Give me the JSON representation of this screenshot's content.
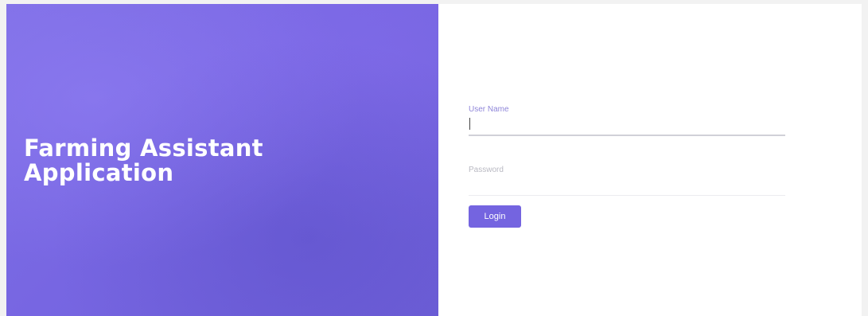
{
  "hero": {
    "title_line1": "Farming Assistant",
    "title_line2": "Application"
  },
  "login_form": {
    "username_label": "User Name",
    "username_value": "",
    "password_label": "Password",
    "password_value": "",
    "login_label": "Login"
  },
  "colors": {
    "accent": "#7464e0",
    "hero_background": "#7766e2"
  }
}
